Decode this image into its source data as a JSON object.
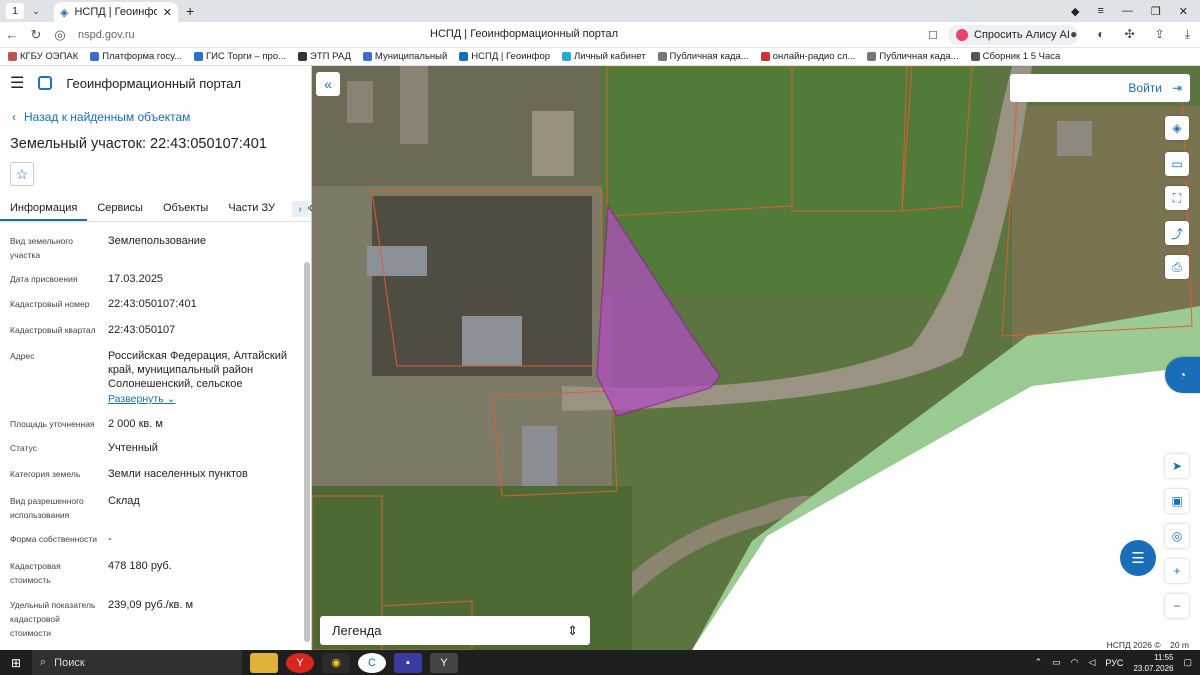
{
  "browser": {
    "tab_number": "1",
    "tab_title": "НСПД | Геоинформационный портал",
    "url": "nspd.gov.ru",
    "page_title": "НСПД | Геоинформационный портал",
    "alice_label": "Спросить Алису AI",
    "bookmarks": [
      {
        "label": "КГБУ ОЭПАК",
        "color": "#b55"
      },
      {
        "label": "Платформа госу...",
        "color": "#3a6fc9"
      },
      {
        "label": "ГИС Торги – про...",
        "color": "#2b74c7"
      },
      {
        "label": "ЭТП РАД",
        "color": "#333"
      },
      {
        "label": "Муниципальный",
        "color": "#3a6fc9"
      },
      {
        "label": "НСПД | Геоинфор",
        "color": "#1a6db8"
      },
      {
        "label": "Личный кабинет",
        "color": "#2aa9d6"
      },
      {
        "label": "Публичная када...",
        "color": "#777"
      },
      {
        "label": "онлайн-радио сл...",
        "color": "#c33"
      },
      {
        "label": "Публичная када...",
        "color": "#777"
      },
      {
        "label": "Сборник 1 5 Часа",
        "color": "#555"
      }
    ]
  },
  "sidebar": {
    "portal_title": "Геоинформационный портал",
    "back_link": "Назад к найденным объектам",
    "object_title": "Земельный участок: 22:43:050107:401",
    "tabs": [
      "Информация",
      "Сервисы",
      "Объекты",
      "Части ЗУ",
      "Состав"
    ],
    "fields": [
      {
        "label": "Вид земельного участка",
        "value": "Землепользование"
      },
      {
        "label": "Дата присвоения",
        "value": "17.03.2025"
      },
      {
        "label": "Кадастровый номер",
        "value": "22:43:050107:401"
      },
      {
        "label": "Кадастровый квартал",
        "value": "22:43:050107"
      },
      {
        "label": "Адрес",
        "value": "Российская Федерация, Алтайский край, муниципальный район Солонешенский, сельское"
      },
      {
        "label": "Площадь уточненная",
        "value": "2 000 кв. м"
      },
      {
        "label": "Статус",
        "value": "Учтенный"
      },
      {
        "label": "Категория земель",
        "value": "Земли населенных пунктов"
      },
      {
        "label": "Вид разрешенного использования",
        "value": "Склад"
      },
      {
        "label": "Форма собственности",
        "value": "-"
      },
      {
        "label": "Кадастровая стоимость",
        "value": "478 180 руб."
      },
      {
        "label": "Удельный показатель кадастровой стоимости",
        "value": "239,09 руб./кв. м"
      }
    ],
    "expand_label": "Развернуть"
  },
  "map": {
    "login_label": "Войти",
    "legend_label": "Легенда",
    "copyright": "НСПД 2026 ©",
    "scale_label": "20 m"
  },
  "taskbar": {
    "search_label": "Поиск",
    "lang": "РУС",
    "time": "11:55",
    "date": "23.07.2026"
  }
}
